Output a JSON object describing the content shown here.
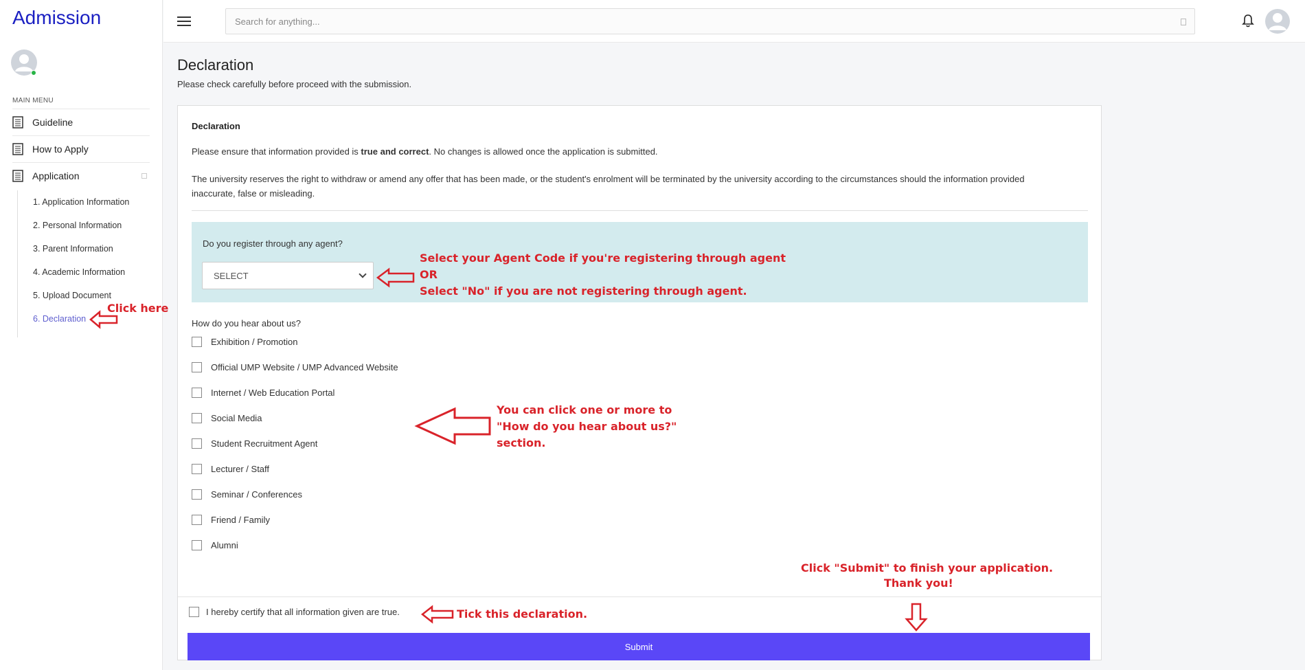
{
  "sidebar": {
    "brand": "Admission",
    "menu_title": "MAIN MENU",
    "items": [
      {
        "label": "Guideline"
      },
      {
        "label": "How to Apply"
      },
      {
        "label": "Application"
      }
    ],
    "subitems": [
      {
        "label": "1. Application Information"
      },
      {
        "label": "2. Personal Information"
      },
      {
        "label": "3. Parent Information"
      },
      {
        "label": "4. Academic Information"
      },
      {
        "label": "5. Upload Document"
      },
      {
        "label": "6. Declaration",
        "active": true
      }
    ]
  },
  "topbar": {
    "search_placeholder": "Search for anything...",
    "icons": [
      "hamburger-icon",
      "search-icon",
      "bell-icon",
      "avatar-icon"
    ]
  },
  "page": {
    "title": "Declaration",
    "subtitle": "Please check carefully before proceed with the submission."
  },
  "card": {
    "title": "Declaration",
    "p1_pre": "Please ensure that information provided is ",
    "p1_bold": "true and correct",
    "p1_post": ". No changes is allowed once the application is submitted.",
    "p2": "The university reserves the right to withdraw or amend any offer that has been made, or the student's enrolment will be terminated by the university according to the circumstances should the information provided inaccurate, false or misleading.",
    "agent_question": "Do you register through any agent?",
    "agent_select_value": "SELECT",
    "hear_label": "How do you hear about us?",
    "hear_options": [
      "Exhibition / Promotion",
      "Official UMP Website / UMP Advanced Website",
      "Internet / Web Education Portal",
      "Social Media",
      "Student Recruitment Agent",
      "Lecturer / Staff",
      "Seminar / Conferences",
      "Friend / Family",
      "Alumni"
    ],
    "certify_label": "I hereby certify that all information given are true.",
    "submit_label": "Submit"
  },
  "annotations": {
    "click_here": "Click here",
    "agent_line1": "Select your Agent Code if you're registering through agent",
    "agent_line2": "OR",
    "agent_line3": "Select \"No\" if you are not registering through agent.",
    "hear_line1": "You can click one or more to",
    "hear_line2": "\"How do you hear about us?\"",
    "hear_line3": "section.",
    "submit_line1": "Click \"Submit\" to finish your application.",
    "submit_line2": "Thank you!",
    "tick": "Tick this declaration."
  },
  "colors": {
    "brand": "#1a1fc2",
    "submit": "#5a47f7",
    "agent_box": "#d3ebee",
    "annotation": "#d9232a"
  }
}
